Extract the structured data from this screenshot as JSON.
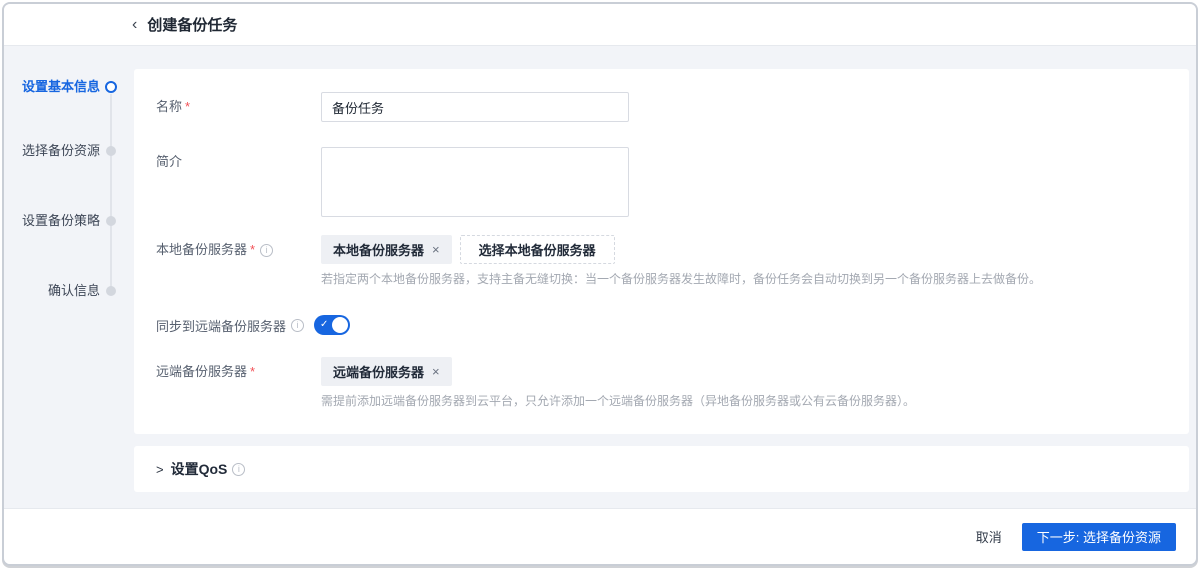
{
  "header": {
    "title": "创建备份任务"
  },
  "icons": {
    "back": "‹",
    "info": "i",
    "close": "×",
    "check": "✓",
    "collapse": ">"
  },
  "steps": {
    "items": [
      {
        "label": "设置基本信息",
        "state": "active"
      },
      {
        "label": "选择备份资源",
        "state": "pending"
      },
      {
        "label": "设置备份策略",
        "state": "pending"
      },
      {
        "label": "确认信息",
        "state": "pending"
      }
    ]
  },
  "form": {
    "name": {
      "label": "名称",
      "required": "*",
      "value": "备份任务"
    },
    "description": {
      "label": "简介",
      "value": ""
    },
    "local_server": {
      "label": "本地备份服务器",
      "required": "*",
      "tag": "本地备份服务器",
      "select_button": "选择本地备份服务器",
      "help": "若指定两个本地备份服务器，支持主备无缝切换：当一个备份服务器发生故障时，备份任务会自动切换到另一个备份服务器上去做备份。"
    },
    "sync_remote": {
      "label": "同步到远端备份服务器",
      "enabled": "true"
    },
    "remote_server": {
      "label": "远端备份服务器",
      "required": "*",
      "tag": "远端备份服务器",
      "help": "需提前添加远端备份服务器到云平台，只允许添加一个远端备份服务器（异地备份服务器或公有云备份服务器）。"
    },
    "qos": {
      "label": "设置QoS"
    }
  },
  "footer": {
    "cancel": "取消",
    "next": "下一步: 选择备份资源"
  },
  "colors": {
    "primary": "#1766e0",
    "step_active": "#1766e0",
    "background": "#f2f4f8"
  }
}
